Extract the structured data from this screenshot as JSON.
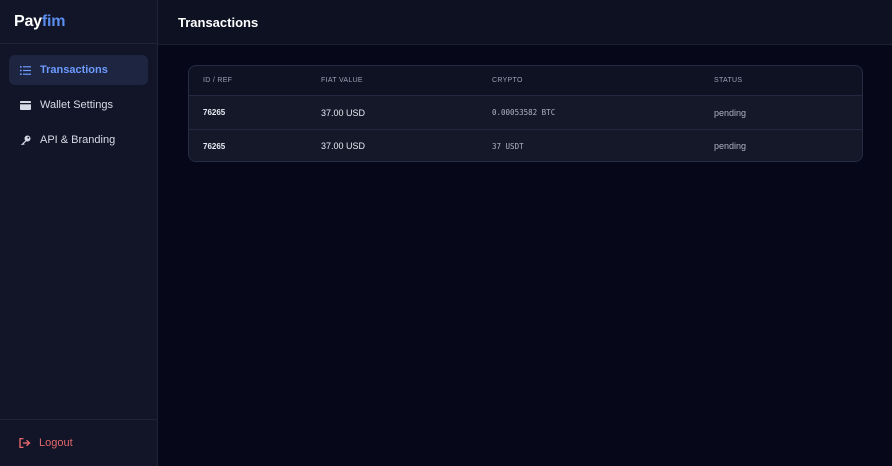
{
  "brand": {
    "part1": "Pay",
    "part2": "fim"
  },
  "sidebar": {
    "items": [
      {
        "label": "Transactions",
        "icon": "list-icon",
        "active": true
      },
      {
        "label": "Wallet Settings",
        "icon": "wallet-icon",
        "active": false
      },
      {
        "label": "API & Branding",
        "icon": "key-icon",
        "active": false
      }
    ],
    "logout": {
      "label": "Logout",
      "icon": "logout-icon"
    }
  },
  "header": {
    "title": "Transactions"
  },
  "table": {
    "columns": [
      "ID / REF",
      "FIAT VALUE",
      "CRYPTO",
      "STATUS"
    ],
    "rows": [
      {
        "id": "76265",
        "fiat": "37.00 USD",
        "crypto": "0.00053582 BTC",
        "status": "pending"
      },
      {
        "id": "76265",
        "fiat": "37.00 USD",
        "crypto": "37 USDT",
        "status": "pending"
      }
    ]
  },
  "colors": {
    "background": "#06081a",
    "sidebar": "#111527",
    "accent": "#6d9bff",
    "logout": "#e2676a"
  }
}
